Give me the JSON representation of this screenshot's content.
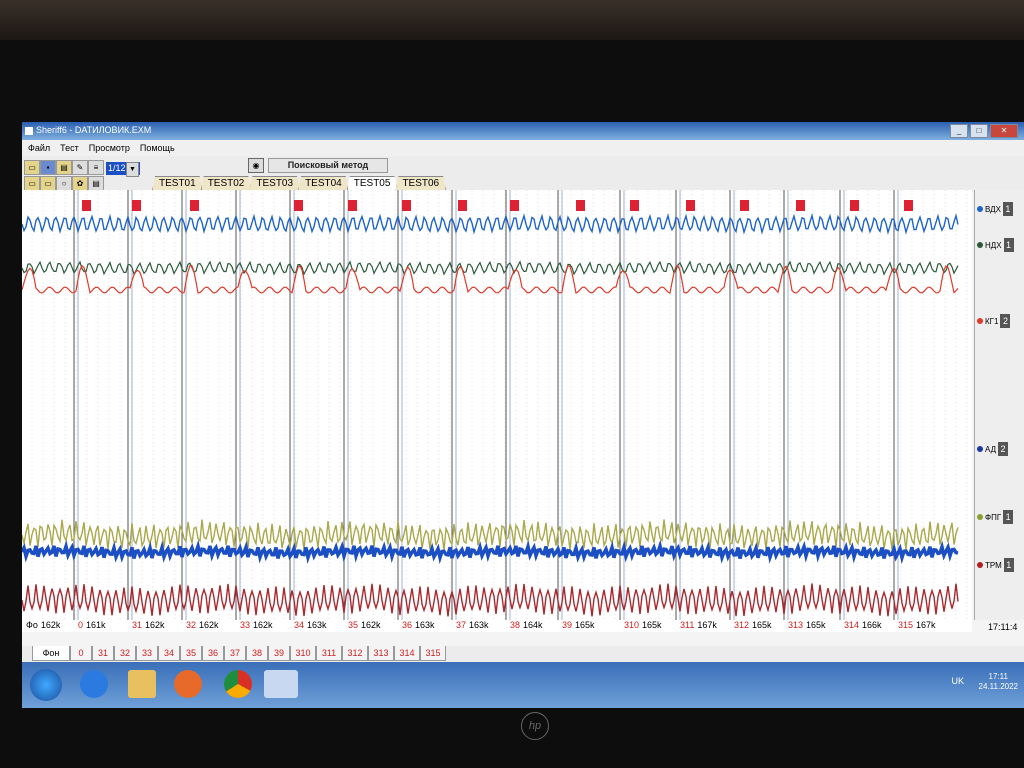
{
  "window": {
    "title": "Sheriff6 - DATИЛОВИК.EXM",
    "controls": [
      "_",
      "□",
      "✕"
    ]
  },
  "menu": [
    "Файл",
    "Тест",
    "Просмотр",
    "Помощь"
  ],
  "toolbar": {
    "zoom_value": "1/12",
    "method_label": "Поисковый метод"
  },
  "tests": [
    "TEST01",
    "TEST02",
    "TEST03",
    "TEST04",
    "TEST05",
    "TEST06"
  ],
  "active_test": "TEST05",
  "channels": [
    {
      "name": "ВДХ",
      "num": "1",
      "color": "#1f64c8"
    },
    {
      "name": "НДХ",
      "num": "1",
      "color": "#2a5a3a"
    },
    {
      "name": "КГ1",
      "num": "2",
      "color": "#e03a2a"
    },
    {
      "name": "АД",
      "num": "2",
      "color": "#1a3aa0"
    },
    {
      "name": "ФПГ",
      "num": "1",
      "color": "#8aa030"
    },
    {
      "name": "ТРМ",
      "num": "1",
      "color": "#b02020"
    }
  ],
  "question_labels": [
    {
      "n": "Фо",
      "v": "162k"
    },
    {
      "n": "0",
      "v": "161k"
    },
    {
      "n": "31",
      "v": "162k"
    },
    {
      "n": "32",
      "v": "162k"
    },
    {
      "n": "33",
      "v": "162k"
    },
    {
      "n": "34",
      "v": "163k"
    },
    {
      "n": "35",
      "v": "162k"
    },
    {
      "n": "36",
      "v": "163k"
    },
    {
      "n": "37",
      "v": "163k"
    },
    {
      "n": "38",
      "v": "164k"
    },
    {
      "n": "39",
      "v": "165k"
    },
    {
      "n": "310",
      "v": "165k"
    },
    {
      "n": "311",
      "v": "167k"
    },
    {
      "n": "312",
      "v": "165k"
    },
    {
      "n": "313",
      "v": "165k"
    },
    {
      "n": "314",
      "v": "166k"
    },
    {
      "n": "315",
      "v": "167k"
    }
  ],
  "chart_time": "17:11:4",
  "bottom_tabs": [
    "Фон",
    "0",
    "31",
    "32",
    "33",
    "34",
    "35",
    "36",
    "37",
    "38",
    "39",
    "310",
    "311",
    "312",
    "313",
    "314",
    "315"
  ],
  "taskbar": {
    "language": "UK",
    "time": "17:11",
    "date": "24.11.2022"
  },
  "bezel_logo": "hp"
}
